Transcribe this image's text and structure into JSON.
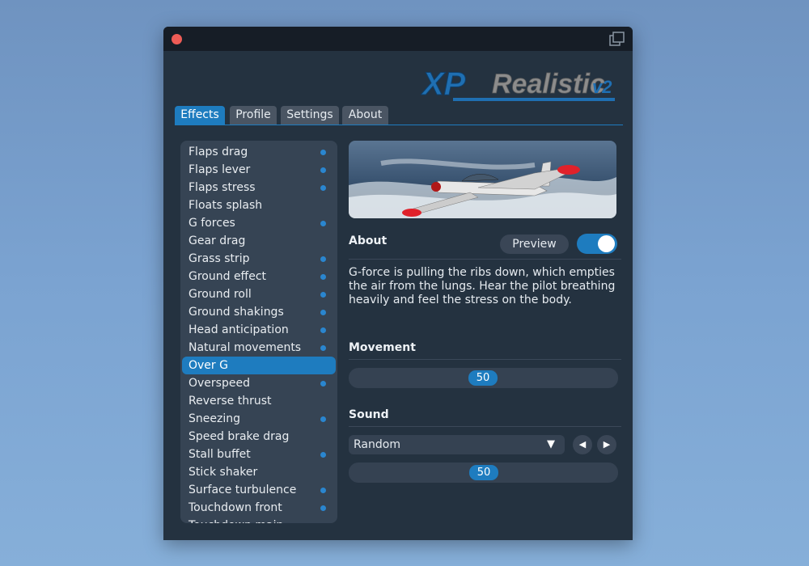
{
  "tabs": [
    {
      "label": "Effects",
      "active": true
    },
    {
      "label": "Profile",
      "active": false
    },
    {
      "label": "Settings",
      "active": false
    },
    {
      "label": "About",
      "active": false
    }
  ],
  "logo_text": "XPRealistic v2",
  "effects": [
    {
      "label": "Flaps drag",
      "enabled": true
    },
    {
      "label": "Flaps lever",
      "enabled": true
    },
    {
      "label": "Flaps stress",
      "enabled": true
    },
    {
      "label": "Floats splash",
      "enabled": false
    },
    {
      "label": "G forces",
      "enabled": true
    },
    {
      "label": "Gear drag",
      "enabled": false
    },
    {
      "label": "Grass strip",
      "enabled": true
    },
    {
      "label": "Ground effect",
      "enabled": true
    },
    {
      "label": "Ground roll",
      "enabled": true
    },
    {
      "label": "Ground shakings",
      "enabled": true
    },
    {
      "label": "Head anticipation",
      "enabled": true
    },
    {
      "label": "Natural movements",
      "enabled": true
    },
    {
      "label": "Over G",
      "enabled": true,
      "selected": true
    },
    {
      "label": "Overspeed",
      "enabled": true
    },
    {
      "label": "Reverse thrust",
      "enabled": false
    },
    {
      "label": "Sneezing",
      "enabled": true
    },
    {
      "label": "Speed brake drag",
      "enabled": false
    },
    {
      "label": "Stall buffet",
      "enabled": true
    },
    {
      "label": "Stick shaker",
      "enabled": false
    },
    {
      "label": "Surface turbulence",
      "enabled": true
    },
    {
      "label": "Touchdown front",
      "enabled": true
    },
    {
      "label": "Touchdown main",
      "enabled": true
    }
  ],
  "detail": {
    "about_title": "About",
    "preview_label": "Preview",
    "preview_on": true,
    "description": "G-force is pulling the ribs down, which empties the air from the lungs. Hear the pilot breathing heavily and feel the stress on the body.",
    "movement_title": "Movement",
    "movement_value": "50",
    "movement_level": 0.5,
    "sound_title": "Sound",
    "sound_option": "Random",
    "sound_value": "50",
    "sound_level": 0.5
  },
  "colors": {
    "accent": "#1e7cbf",
    "window_bg": "#243240",
    "list_bg": "#364454",
    "close": "#ee5c56"
  }
}
